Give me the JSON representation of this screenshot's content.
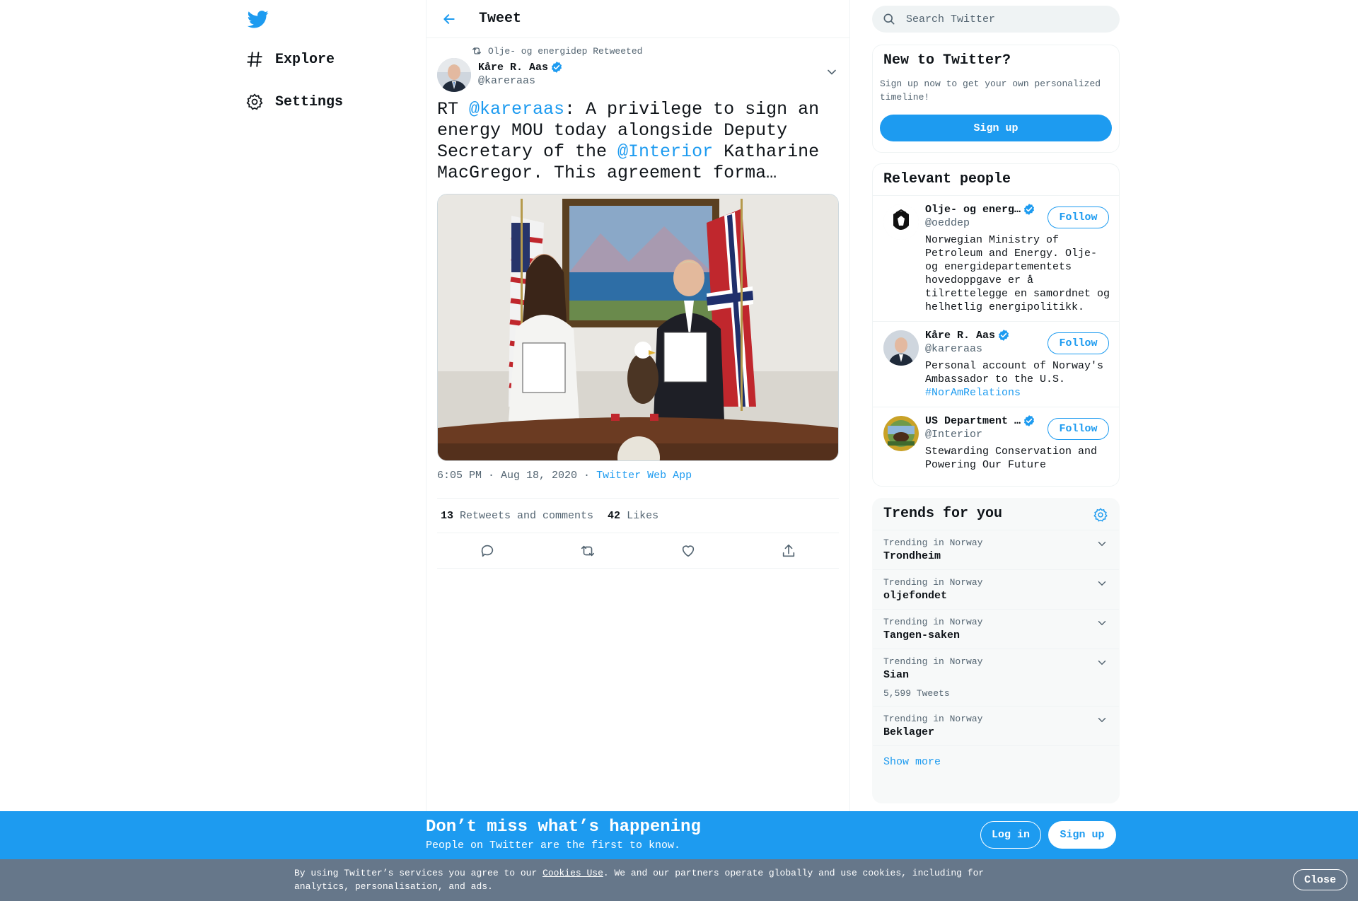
{
  "colors": {
    "accent": "#1d9bf0",
    "text": "#0f1419",
    "secondary": "#536471",
    "cookie_bar": "#66778a"
  },
  "nav": {
    "logo_icon": "twitter-bird-icon",
    "items": [
      {
        "label": "Explore",
        "icon": "hashtag-icon"
      },
      {
        "label": "Settings",
        "icon": "gear-icon"
      }
    ]
  },
  "header": {
    "title": "Tweet",
    "back_icon": "arrow-left-icon"
  },
  "tweet": {
    "retweet_context": "Olje- og energidep Retweeted",
    "author_name": "Kåre R. Aas",
    "author_handle": "@kareraas",
    "text": {
      "prefix": "RT ",
      "mention1": "@kareraas",
      "middle": ": A privilege to sign an energy MOU today alongside Deputy Secretary of the ",
      "mention2": "@Interior",
      "suffix": " Katharine MacGregor. This agreement forma…"
    },
    "time": "6:05 PM · Aug 18, 2020",
    "separator": " · ",
    "source": "Twitter Web App",
    "retweets_count": "13",
    "retweets_label": "Retweets and comments",
    "likes_count": "42",
    "likes_label": "Likes",
    "actions": [
      "reply-icon",
      "retweet-icon",
      "like-icon",
      "share-icon"
    ]
  },
  "search": {
    "placeholder": "Search Twitter"
  },
  "new_to_twitter": {
    "title": "New to Twitter?",
    "subtitle": "Sign up now to get your own personalized timeline!",
    "signup_label": "Sign up"
  },
  "relevant_people": {
    "title": "Relevant people",
    "follow_label": "Follow",
    "people": [
      {
        "name": "Olje- og energ…",
        "handle": "@oeddep",
        "bio": "Norwegian Ministry of Petroleum and Energy. Olje- og energidepartementets hovedoppgave er å tilrettelegge en samordnet og helhetlig energipolitikk.",
        "tag": ""
      },
      {
        "name": "Kåre R. Aas",
        "handle": "@kareraas",
        "bio": "Personal account of Norway's Ambassador to the U.S. ",
        "tag": "#NorAmRelations"
      },
      {
        "name": "US Department …",
        "handle": "@Interior",
        "bio": "Stewarding Conservation and Powering Our Future",
        "tag": ""
      }
    ]
  },
  "trends": {
    "title": "Trends for you",
    "items": [
      {
        "context": "Trending in Norway",
        "name": "Trondheim",
        "count": ""
      },
      {
        "context": "Trending in Norway",
        "name": "oljefondet",
        "count": ""
      },
      {
        "context": "Trending in Norway",
        "name": "Tangen-saken",
        "count": ""
      },
      {
        "context": "Trending in Norway",
        "name": "Sian",
        "count": "5,599 Tweets"
      },
      {
        "context": "Trending in Norway",
        "name": "Beklager",
        "count": ""
      }
    ],
    "show_more": "Show more"
  },
  "banner": {
    "title": "Don’t miss what’s happening",
    "subtitle": "People on Twitter are the first to know.",
    "login_label": "Log in",
    "signup_label": "Sign up"
  },
  "cookie": {
    "before": "By using Twitter’s services you agree to our ",
    "link": "Cookies Use",
    "after": ". We and our partners operate globally and use cookies, including for analytics, personalisation, and ads.",
    "close_label": "Close"
  }
}
